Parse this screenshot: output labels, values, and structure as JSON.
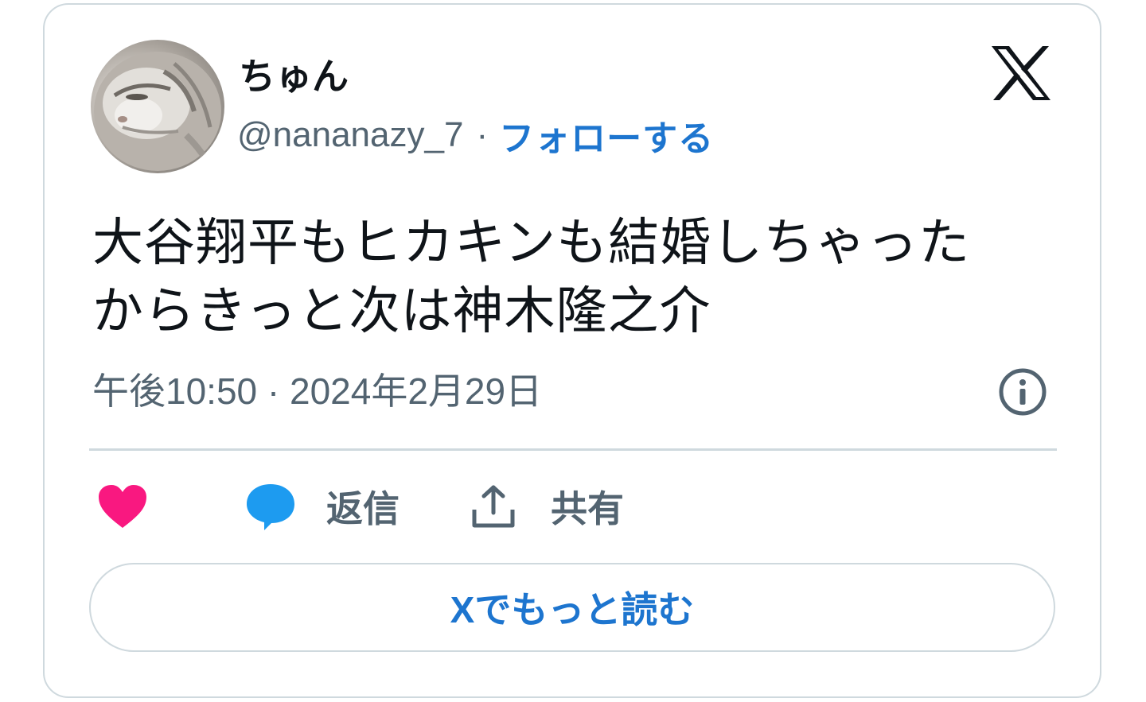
{
  "author": {
    "display_name": "ちゅん",
    "handle": "@nananazy_7",
    "separator": "·",
    "follow_label": "フォローする"
  },
  "tweet": {
    "text_line1": "大谷翔平もヒカキンも結婚しちゃった",
    "text_line2": "からきっと次は神木隆之介",
    "timestamp": "午後10:50 · 2024年2月29日"
  },
  "actions": {
    "reply_label": "返信",
    "share_label": "共有"
  },
  "read_more_label": "Xでもっと読む",
  "icons": {
    "brand": "x-logo-icon",
    "info": "info-icon",
    "like": "heart-icon",
    "reply": "speech-bubble-icon",
    "share": "share-upload-icon"
  },
  "colors": {
    "link": "#1d75cf",
    "heart": "#f91880",
    "reply_bubble": "#1d9bf0",
    "muted": "#536471",
    "text": "#0f1419",
    "border": "#cfd9de"
  }
}
